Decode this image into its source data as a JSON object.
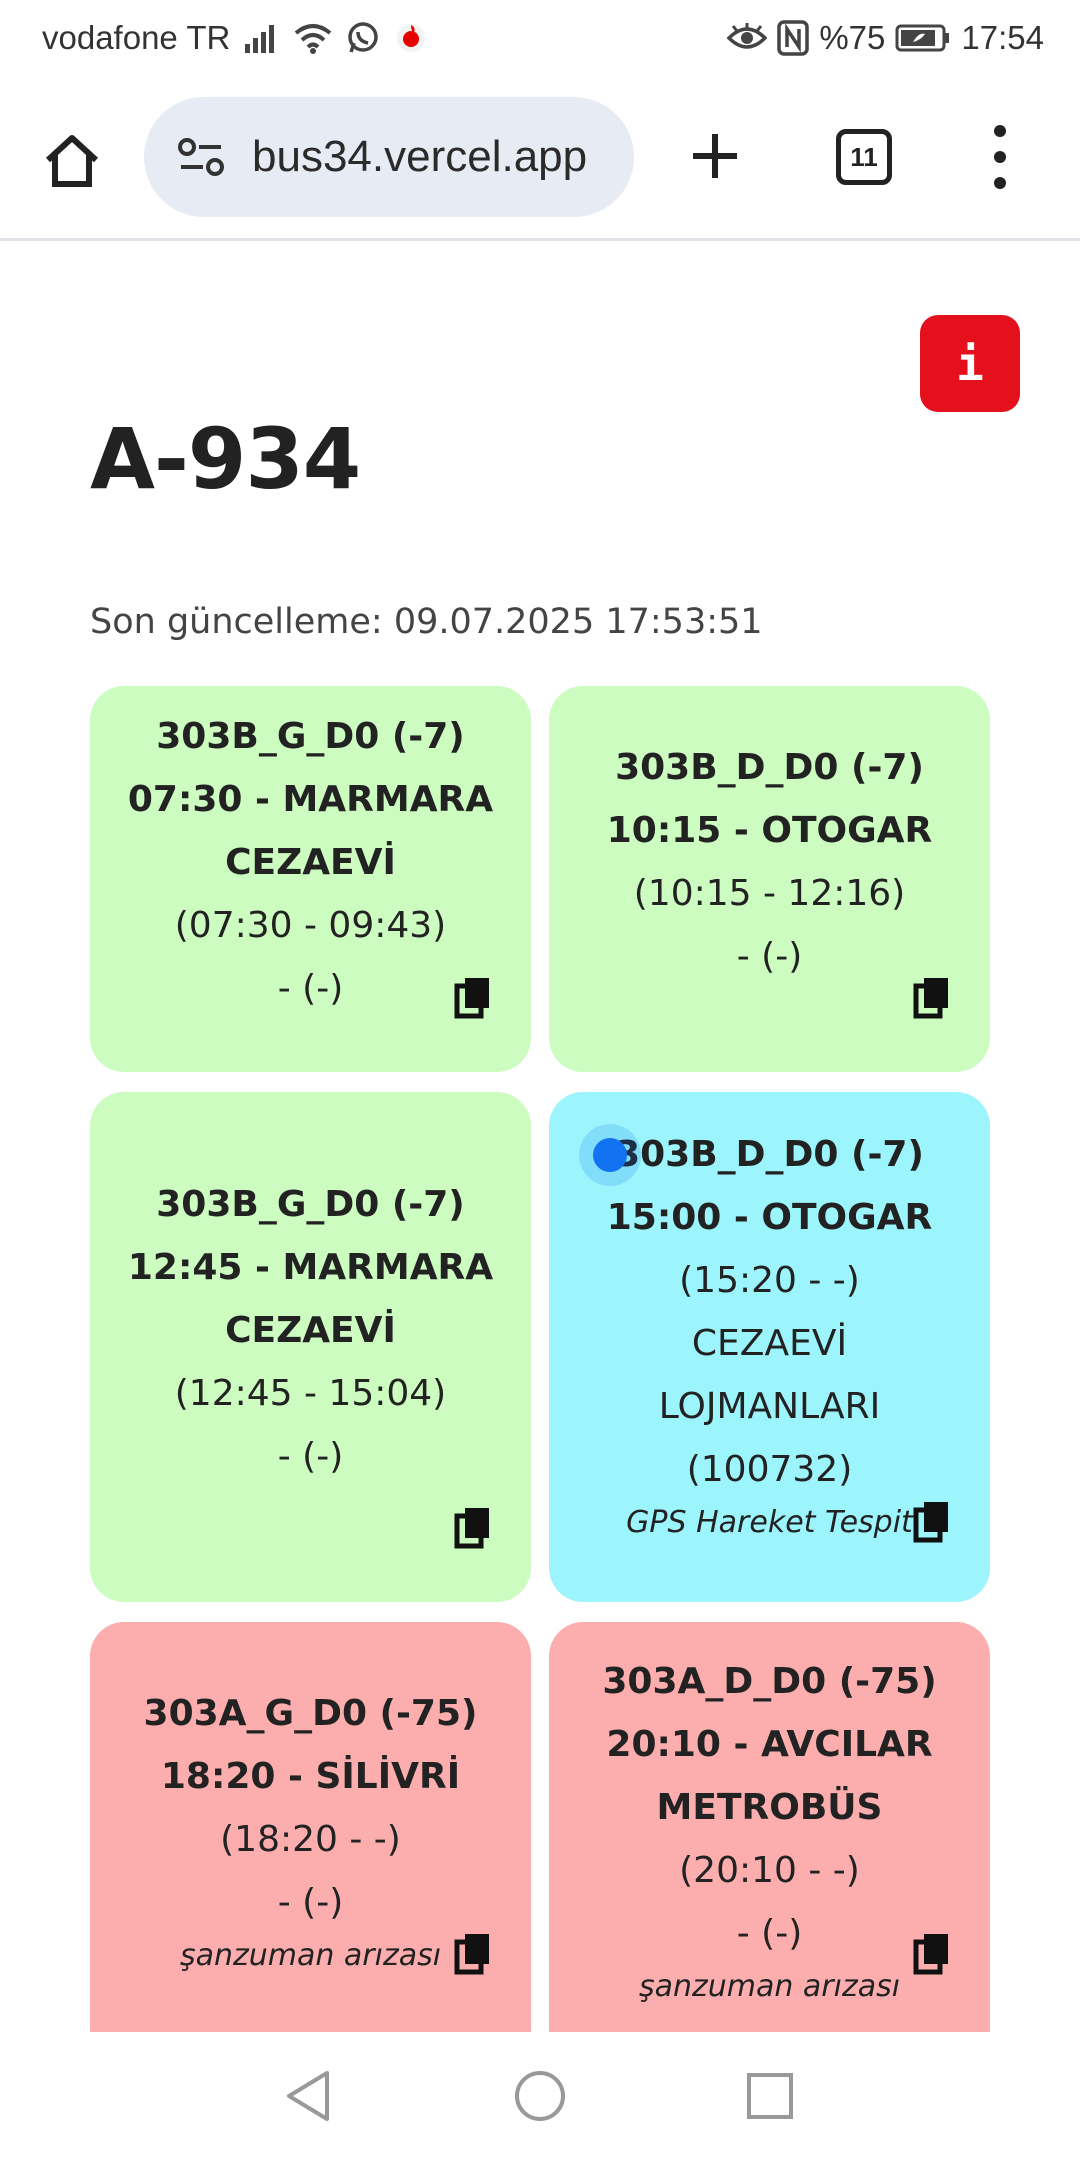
{
  "status_bar": {
    "carrier": "vodafone TR",
    "battery": "%75",
    "time": "17:54",
    "icons": [
      "signal-icon",
      "wifi-icon",
      "whatsapp-icon",
      "vodafone-icon",
      "eye-icon",
      "nfc-icon",
      "battery-icon"
    ]
  },
  "browser": {
    "url": "bus34.vercel.app",
    "tab_count": "11",
    "icons": [
      "home-icon",
      "site-settings-icon",
      "plus-icon",
      "tabs-icon",
      "more-vert-icon"
    ]
  },
  "page": {
    "info_label": "i",
    "title": "A-934",
    "last_updated": "Son güncelleme: 09.07.2025 17:53:51"
  },
  "cards": [
    {
      "status": "completed",
      "color": "#ccfcc0",
      "line1": "303B_G_D0 (-7)",
      "line2": "07:30 - MARMARA",
      "line3": "CEZAEVİ",
      "times": "(07:30 - 09:43)",
      "extra": "- (-)"
    },
    {
      "status": "completed",
      "color": "#ccfcc0",
      "line1": "303B_D_D0 (-7)",
      "line2": "10:15 - OTOGAR",
      "times": "(10:15 - 12:16)",
      "extra": "- (-)"
    },
    {
      "status": "completed",
      "color": "#ccfcc0",
      "line1": "303B_G_D0 (-7)",
      "line2": "12:45 - MARMARA",
      "line3": "CEZAEVİ",
      "times": "(12:45 - 15:04)",
      "extra": "- (-)"
    },
    {
      "status": "active",
      "color": "#9cf4fc",
      "line1": "303B_D_D0 (-7)",
      "line2": "15:00 - OTOGAR",
      "times": "(15:20 - -)",
      "stop1": "CEZAEVİ",
      "stop2": "LOJMANLARI",
      "stop_code": "(100732)",
      "note": "GPS Hareket Tespit"
    },
    {
      "status": "cancelled",
      "color": "#fcaeae",
      "line1": "303A_G_D0 (-75)",
      "line2": "18:20 - SİLİVRİ",
      "times": "(18:20 - -)",
      "extra": "- (-)",
      "note": "şanzuman arızası"
    },
    {
      "status": "cancelled",
      "color": "#fcaeae",
      "line1": "303A_D_D0 (-75)",
      "line2": "20:10 - AVCILAR",
      "line3": "METROBÜS",
      "times": "(20:10 - -)",
      "extra": "- (-)",
      "note": "şanzuman arızası"
    }
  ],
  "nav": {
    "icons": [
      "back-icon",
      "home-circle-icon",
      "recents-icon"
    ]
  }
}
